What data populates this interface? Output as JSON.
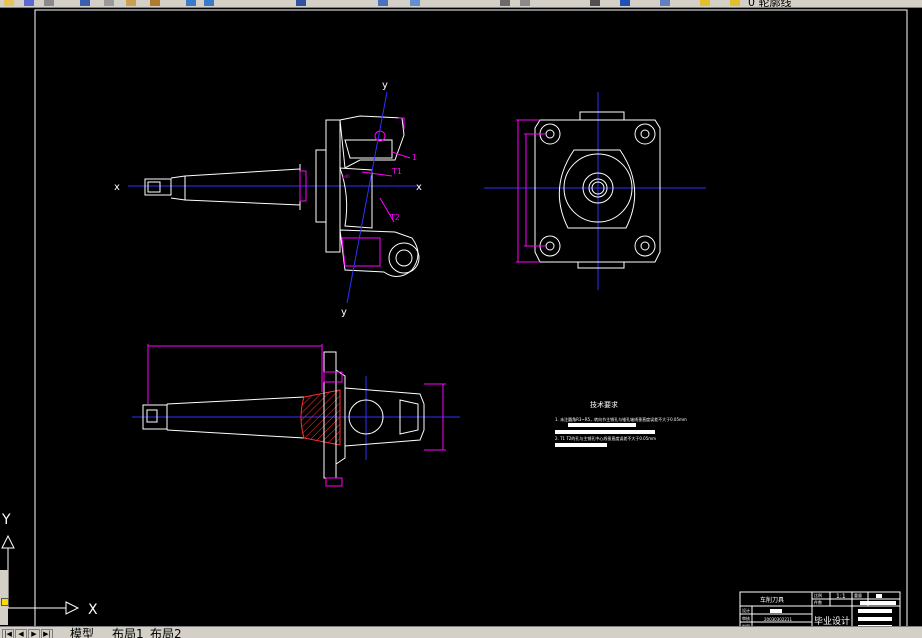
{
  "toolbar": {
    "layer_name": "0 轮廓线"
  },
  "drawing": {
    "axis_x_label": "x",
    "axis_y_label": "y",
    "label_1": "1",
    "label_t1": "T1",
    "label_t2": "T2",
    "tech_requirements": {
      "title": "技术要求",
      "item1": "1. 未注圆角R3~R5，转向节主销孔与锥孔轴线垂直度误差不大于0.05mm",
      "item2": "2. T1 T2的孔与主销孔中心线垂直度误差不大于0.05mm"
    },
    "title_block": {
      "part_name": "车削刀具",
      "scale_label": "比例",
      "scale_value": "1:1",
      "weight_label": "重量",
      "count_label": "件数",
      "designer_label": "设计",
      "checker_label": "审核",
      "drawn_label": "制图",
      "student_id": "20030302211",
      "school_label": "毕业设计"
    }
  },
  "ucs": {
    "x_label": "X",
    "y_label": "Y"
  },
  "tabs": {
    "model": "模型",
    "layout1": "布局1",
    "layout2": "布局2"
  },
  "colors": {
    "background": "#000000",
    "geometry": "#ffffff",
    "centerline": "#3030ff",
    "dimension": "#ff00ff",
    "hatch": "#ff3030"
  }
}
